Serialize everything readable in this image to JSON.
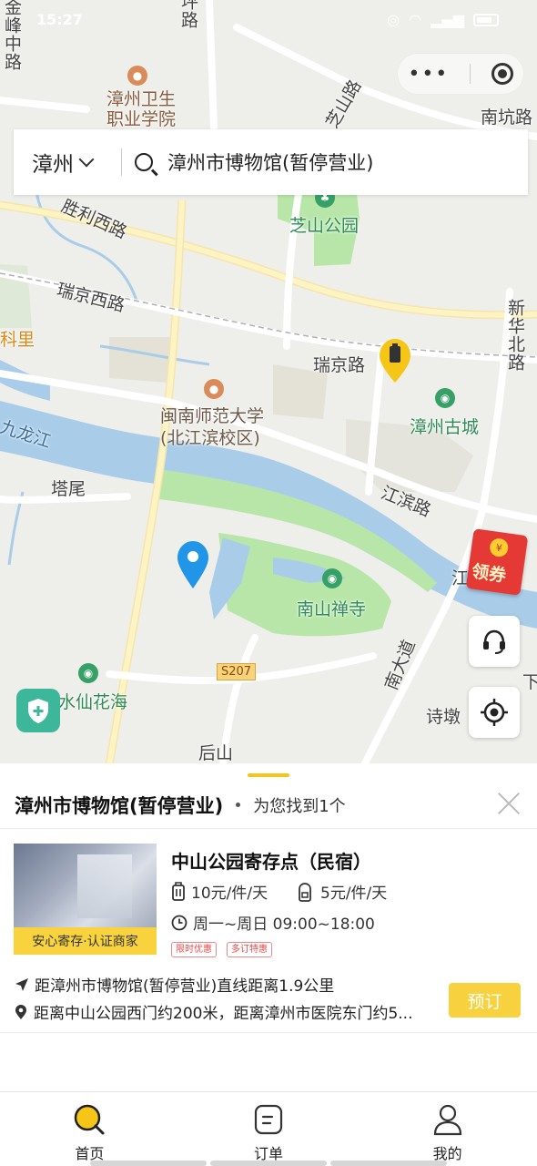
{
  "status_bar": {
    "time": "15:27",
    "battery": "33"
  },
  "capsule": {
    "more_icon": "more-dots-icon",
    "close_icon": "miniapp-close-icon"
  },
  "search": {
    "city": "漳州",
    "query": "漳州市博物馆(暂停营业)"
  },
  "map": {
    "labels": {
      "jinfeng_road": "金峰中路",
      "xx_road_top": "坪路",
      "health_college": "漳州卫生职业学院",
      "nankeng_road": "南坑路",
      "zhisan_road": "芝山路",
      "zhishan_park": "芝山公园",
      "shengli_west": "胜利西路",
      "ruijing_west": "瑞京西路",
      "keli": "科里",
      "xinhua_north": "新华北路",
      "ruijing_road": "瑞京路",
      "minnan_univ": "闽南师范大学",
      "beijiang_campus": "(北江滨校区)",
      "zhangzhou_ancient": "漳州古城",
      "jiulong_river": "九龙江",
      "tawei": "塔尾",
      "jiangbin_road": "江滨路",
      "jiang_right": "江滨",
      "nanshan_temple": "南山禅寺",
      "nanda_road": "南大道",
      "xia": "下",
      "s207": "S207",
      "shuixian_flower": "水仙花海",
      "shidun": "诗墩",
      "houshan": "后山"
    },
    "marker_icon": "luggage-storage-marker-icon",
    "pin_icon": "location-pin-icon"
  },
  "floating": {
    "coupon_label": "领券",
    "coupon_coin": "¥"
  },
  "sheet": {
    "title": "漳州市博物馆(暂停营业)",
    "result_count": "为您找到1个",
    "store": {
      "name": "中山公园寄存点（民宿）",
      "badge": "安心寄存·认证商家",
      "price_luggage": "10元/件/天",
      "price_bag": "5元/件/天",
      "hours": "周一~周日 09:00~18:00",
      "tags": [
        "限时优惠",
        "多订特惠"
      ],
      "distance": "距漳州市博物馆(暂停营业)直线距离1.9公里",
      "address": "距离中山公园西门约200米，距离漳州市医院东门约5...",
      "book_label": "预订"
    }
  },
  "tabs": [
    {
      "label": "首页",
      "icon": "home-search-icon",
      "active": true
    },
    {
      "label": "订单",
      "icon": "orders-icon",
      "active": false
    },
    {
      "label": "我的",
      "icon": "profile-icon",
      "active": false
    }
  ]
}
